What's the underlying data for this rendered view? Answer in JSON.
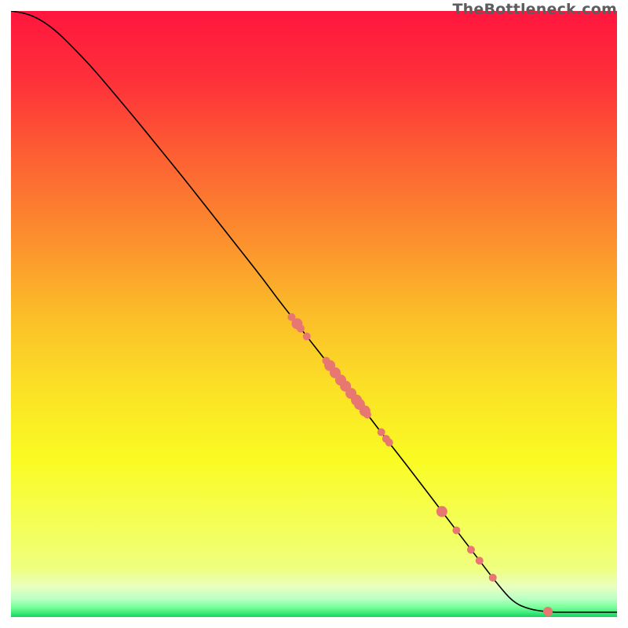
{
  "attribution": "TheBottleneck.com",
  "icon_labels": {
    "point": "data-point"
  },
  "chart_data": {
    "type": "line",
    "title": "",
    "xlabel": "",
    "ylabel": "",
    "xlim": [
      0,
      100
    ],
    "ylim": [
      0,
      100
    ],
    "grid": false,
    "legend": false,
    "background_gradient": [
      {
        "pos": 0.0,
        "color": "#FF163E"
      },
      {
        "pos": 0.12,
        "color": "#FE3239"
      },
      {
        "pos": 0.24,
        "color": "#FD6033"
      },
      {
        "pos": 0.37,
        "color": "#FC8D2E"
      },
      {
        "pos": 0.5,
        "color": "#FBBD29"
      },
      {
        "pos": 0.62,
        "color": "#FBE026"
      },
      {
        "pos": 0.74,
        "color": "#FAFB23"
      },
      {
        "pos": 0.86,
        "color": "#F3FF5D"
      },
      {
        "pos": 0.92,
        "color": "#EFFF7F"
      },
      {
        "pos": 0.95,
        "color": "#E8FFC0"
      },
      {
        "pos": 0.97,
        "color": "#BBFFC5"
      },
      {
        "pos": 0.984,
        "color": "#77FF98"
      },
      {
        "pos": 0.992,
        "color": "#46EC7F"
      },
      {
        "pos": 1.0,
        "color": "#11D562"
      }
    ],
    "series": [
      {
        "name": "curve",
        "color": "#000000",
        "linewidth": 1.6,
        "x": [
          0.0,
          2.6,
          5.2,
          7.8,
          10.4,
          13.0,
          15.5,
          18.1,
          20.7,
          23.3,
          25.9,
          28.5,
          31.1,
          33.7,
          36.3,
          38.9,
          41.5,
          44.0,
          46.6,
          49.2,
          51.8,
          54.4,
          57.0,
          59.6,
          62.2,
          64.8,
          67.4,
          70.0,
          72.5,
          75.1,
          77.7,
          80.3,
          82.9,
          85.5,
          88.1,
          89.6,
          90.4,
          91.2,
          92.0,
          92.2,
          100.0
        ],
        "y": [
          100.0,
          99.6,
          98.4,
          96.4,
          93.8,
          91.1,
          88.2,
          85.1,
          82.0,
          78.8,
          75.6,
          72.4,
          69.1,
          65.8,
          62.5,
          59.2,
          55.9,
          52.5,
          49.2,
          45.8,
          42.5,
          39.1,
          35.8,
          32.4,
          29.0,
          25.7,
          22.3,
          18.9,
          15.6,
          12.2,
          8.8,
          5.4,
          2.4,
          1.3,
          0.9,
          0.8,
          0.8,
          0.8,
          0.8,
          0.8,
          0.8
        ]
      }
    ],
    "points": [
      {
        "x": 46.3,
        "y": 49.5,
        "r": 5
      },
      {
        "x": 47.2,
        "y": 48.4,
        "r": 7
      },
      {
        "x": 47.8,
        "y": 47.6,
        "r": 5
      },
      {
        "x": 48.8,
        "y": 46.3,
        "r": 5
      },
      {
        "x": 52.0,
        "y": 42.3,
        "r": 5
      },
      {
        "x": 52.6,
        "y": 41.5,
        "r": 7
      },
      {
        "x": 53.5,
        "y": 40.3,
        "r": 7
      },
      {
        "x": 54.4,
        "y": 39.1,
        "r": 7
      },
      {
        "x": 55.2,
        "y": 38.1,
        "r": 7
      },
      {
        "x": 56.1,
        "y": 36.9,
        "r": 7
      },
      {
        "x": 57.0,
        "y": 35.8,
        "r": 7
      },
      {
        "x": 57.5,
        "y": 35.1,
        "r": 7
      },
      {
        "x": 58.4,
        "y": 34.0,
        "r": 7
      },
      {
        "x": 58.8,
        "y": 33.4,
        "r": 5
      },
      {
        "x": 61.1,
        "y": 30.5,
        "r": 5
      },
      {
        "x": 61.9,
        "y": 29.4,
        "r": 5
      },
      {
        "x": 62.4,
        "y": 28.8,
        "r": 5
      },
      {
        "x": 71.1,
        "y": 17.4,
        "r": 7
      },
      {
        "x": 73.5,
        "y": 14.3,
        "r": 5
      },
      {
        "x": 75.9,
        "y": 11.1,
        "r": 5
      },
      {
        "x": 77.3,
        "y": 9.3,
        "r": 5
      },
      {
        "x": 79.5,
        "y": 6.5,
        "r": 5
      },
      {
        "x": 88.6,
        "y": 0.9,
        "r": 6
      }
    ],
    "point_style": {
      "fill": "#E77770",
      "stroke": "none"
    }
  }
}
